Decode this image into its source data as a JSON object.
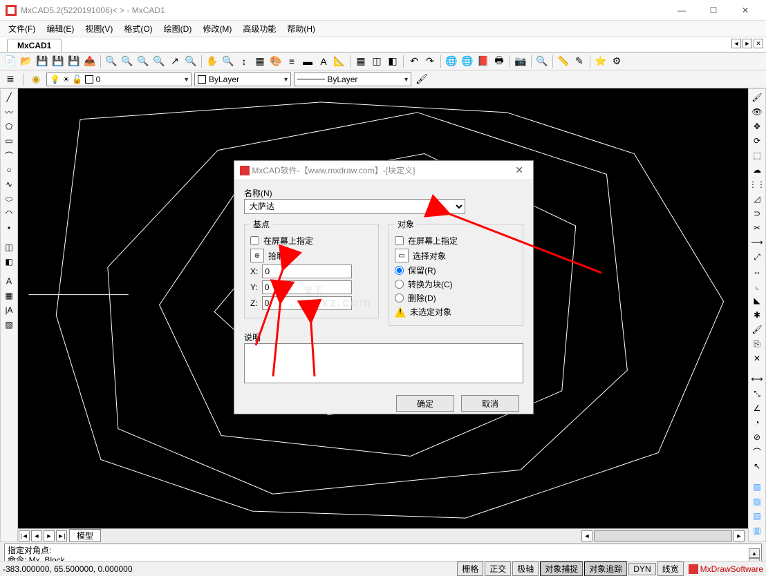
{
  "window": {
    "title": "MxCAD5.2(5220191006)< > - MxCAD1"
  },
  "menu": {
    "file": "文件(F)",
    "edit": "编辑(E)",
    "view": "视图(V)",
    "format": "格式(O)",
    "draw": "绘图(D)",
    "modify": "修改(M)",
    "advanced": "高级功能",
    "help": "帮助(H)"
  },
  "doc_tab": "MxCAD1",
  "layer": {
    "current": "0",
    "color_combo": "ByLayer",
    "linetype_combo": "ByLayer"
  },
  "bottom_tab": "模型",
  "command": {
    "line1": "指定对角点:",
    "line2": "命令: Mx_Block"
  },
  "status": {
    "coords": "-383.000000, 65.500000,  0.000000",
    "grid": "栅格",
    "ortho": "正交",
    "polar": "极轴",
    "osnap": "对象捕捉",
    "otrack": "对象追踪",
    "dyn": "DYN",
    "lw": "线宽",
    "brand": "MxDrawSoftware"
  },
  "dialog": {
    "title": "MxCAD软件-【www.mxdraw.com】-[块定义]",
    "name_label": "名称(N)",
    "name_value": "大萨达",
    "basepoint_legend": "基点",
    "on_screen": "在屏幕上指定",
    "pick_point": "拾取点",
    "x_label": "X:",
    "y_label": "Y:",
    "z_label": "Z:",
    "x_val": "0",
    "y_val": "0",
    "z_val": "0",
    "objects_legend": "对象",
    "select_obj": "选择对象",
    "keep": "保留(R)",
    "convert": "转换为块(C)",
    "delete": "删除(D)",
    "no_selection": "未选定对象",
    "desc_label": "说明",
    "ok": "确定",
    "cancel": "取消"
  },
  "watermark": {
    "line1": "安下",
    "line2": "anxz.com"
  }
}
